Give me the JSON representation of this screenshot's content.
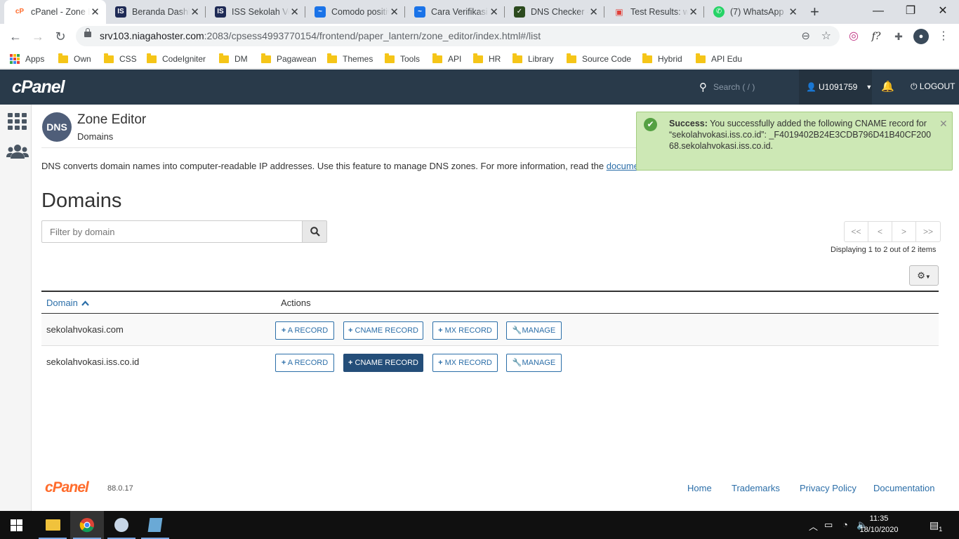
{
  "browser": {
    "tabs": [
      {
        "title": "cPanel - Zone Editor",
        "fav_color": "#ff6c2c",
        "fav_glyph": "cP"
      },
      {
        "title": "Beranda Dashboard",
        "fav_color": "#1e2a55",
        "fav_glyph": "IS"
      },
      {
        "title": "ISS Sekolah Vokasi",
        "fav_color": "#1e2a55",
        "fav_glyph": "IS"
      },
      {
        "title": "Comodo positive",
        "fav_color": "#1a73e8",
        "fav_glyph": "~"
      },
      {
        "title": "Cara Verifikasi",
        "fav_color": "#1a73e8",
        "fav_glyph": "~"
      },
      {
        "title": "DNS Checker - DNS",
        "fav_color": "#2c4a1e",
        "fav_glyph": "✓"
      },
      {
        "title": "Test Results: www",
        "fav_color": "#e0403a",
        "fav_glyph": "🔓"
      },
      {
        "title": "(7) WhatsApp",
        "fav_color": "#25d366",
        "fav_glyph": "✆"
      }
    ],
    "url_host": "srv103.niagahoster.com",
    "url_rest": ":2083/cpsess4993770154/frontend/paper_lantern/zone_editor/index.html#/list",
    "bookmarks": [
      "Apps",
      "Own",
      "CSS",
      "CodeIgniter",
      "DM",
      "Pagawean",
      "Themes",
      "Tools",
      "API",
      "HR",
      "Library",
      "Source Code",
      "Hybrid",
      "API Edu"
    ]
  },
  "cpanel": {
    "logo": "cPanel",
    "search_placeholder": "Search ( / )",
    "user": "U1091759",
    "logout": "LOGOUT",
    "page_icon_text": "DNS",
    "page_title": "Zone Editor",
    "page_subtitle": "Domains",
    "intro_text": "DNS converts domain names into computer-readable IP addresses. Use this feature to manage DNS zones. For more information, read the ",
    "intro_link": "documentation",
    "section_title": "Domains",
    "filter_placeholder": "Filter by domain",
    "pager": [
      "<<",
      "<",
      ">",
      ">>"
    ],
    "displaying": "Displaying 1 to 2 out of 2 items",
    "col_domain": "Domain",
    "col_actions": "Actions",
    "rows": [
      {
        "domain": "sekolahvokasi.com",
        "a": "A RECORD",
        "cname": "CNAME RECORD",
        "mx": "MX RECORD",
        "manage": "MANAGE"
      },
      {
        "domain": "sekolahvokasi.iss.co.id",
        "a": "A RECORD",
        "cname": "CNAME RECORD",
        "mx": "MX RECORD",
        "manage": "MANAGE"
      }
    ],
    "toast": {
      "strong": "Success:",
      "text": " You successfully added the following CNAME record for “sekolahvokasi.iss.co.id”: _F4019402B24E3CDB796D41B40CF20068.sekolahvokasi.iss.co.id."
    },
    "footer": {
      "logo": "cPanel",
      "version": "88.0.17",
      "links": [
        "Home",
        "Trademarks",
        "Privacy Policy",
        "Documentation"
      ]
    }
  },
  "taskbar": {
    "time": "11:35",
    "date": "18/10/2020",
    "notif_count": "1"
  },
  "colors": {
    "cpanel_header": "#293a4a",
    "link_blue": "#2b6ea8",
    "cname_active": "#244e79",
    "toast_bg": "#cde8b5",
    "cpanel_orange": "#ff6c2c"
  }
}
